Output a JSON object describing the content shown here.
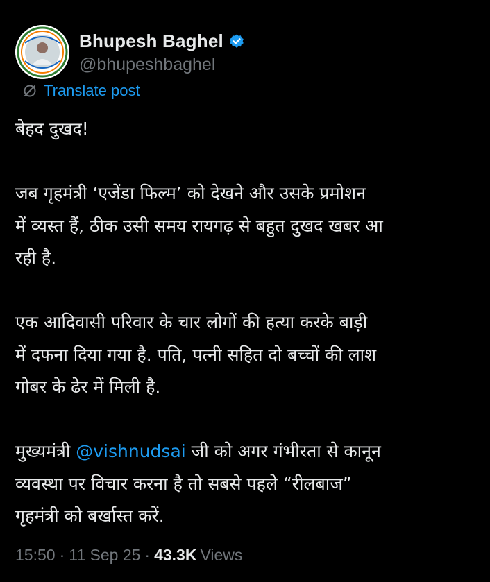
{
  "post": {
    "author": {
      "display_name": "Bhupesh Baghel",
      "handle": "@bhupeshbaghel",
      "verified": true,
      "verified_color": "#1d9bf0"
    },
    "translate_label": "Translate post",
    "paragraphs": [
      [
        "बेहद दुखद!"
      ],
      [
        "जब गृहमंत्री ‘एजेंडा फिल्म’ को देखने और उसके प्रमोशन",
        "में व्यस्त हैं, ठीक उसी समय रायगढ़ से बहुत दुखद खबर आ",
        "रही है."
      ],
      [
        "एक आदिवासी परिवार के चार लोगों की हत्या करके बाड़ी",
        "में दफना दिया गया है. पति, पत्नी सहित दो बच्चों की लाश",
        "गोबर के ढेर में मिली है."
      ]
    ],
    "last_paragraph": {
      "before_mention": "मुख्यमंत्री ",
      "mention": "@vishnudsai",
      "after_mention": " जी को अगर गंभीरता से कानून",
      "line2": "व्यवस्था पर विचार करना है तो सबसे पहले “रीलबाज”",
      "line3": "गृहमंत्री को बर्खास्त करें."
    },
    "time": "15:50",
    "date": "11 Sep 25",
    "views_count": "43.3K",
    "views_label": "Views",
    "separator": "·"
  },
  "colors": {
    "background": "#000000",
    "text": "#e7e9ea",
    "secondary": "#71767b",
    "accent": "#1d9bf0"
  }
}
